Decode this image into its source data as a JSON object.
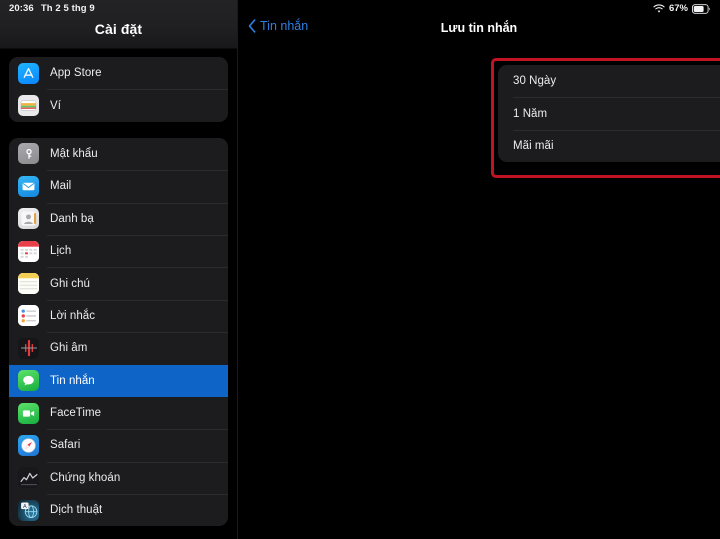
{
  "status_bar": {
    "time": "20:36",
    "date": "Th 2 5 thg 9",
    "wifi_icon": "wifi-icon",
    "battery_percent": "67%",
    "battery_icon": "battery-icon"
  },
  "sidebar": {
    "title": "Cài đặt",
    "groups": [
      {
        "items": [
          {
            "label": "App Store",
            "icon": "app-store-icon",
            "selected": false
          },
          {
            "label": "Ví",
            "icon": "wallet-icon",
            "selected": false
          }
        ]
      },
      {
        "items": [
          {
            "label": "Mật khẩu",
            "icon": "passwords-key-icon",
            "selected": false
          },
          {
            "label": "Mail",
            "icon": "mail-envelope-icon",
            "selected": false
          },
          {
            "label": "Danh bạ",
            "icon": "contacts-icon",
            "selected": false
          },
          {
            "label": "Lịch",
            "icon": "calendar-icon",
            "selected": false
          },
          {
            "label": "Ghi chú",
            "icon": "notes-icon",
            "selected": false
          },
          {
            "label": "Lời nhắc",
            "icon": "reminders-icon",
            "selected": false
          },
          {
            "label": "Ghi âm",
            "icon": "voice-memos-icon",
            "selected": false
          },
          {
            "label": "Tin nhắn",
            "icon": "messages-icon",
            "selected": true
          },
          {
            "label": "FaceTime",
            "icon": "facetime-icon",
            "selected": false
          },
          {
            "label": "Safari",
            "icon": "safari-compass-icon",
            "selected": false
          },
          {
            "label": "Chứng khoán",
            "icon": "stocks-icon",
            "selected": false
          },
          {
            "label": "Dịch thuật",
            "icon": "translate-icon",
            "selected": false
          }
        ]
      }
    ]
  },
  "content": {
    "back_label": "Tin nhắn",
    "back_icon": "chevron-left-icon",
    "title": "Lưu tin nhắn",
    "options": [
      {
        "label": "30 Ngày",
        "checked": true
      },
      {
        "label": "1 Năm",
        "checked": false
      },
      {
        "label": "Mãi mãi",
        "checked": false
      }
    ],
    "checkmark_icon": "checkmark-icon",
    "highlight_color": "#c01424"
  },
  "colors": {
    "selection_blue": "#0f64c8",
    "accent_blue": "#2f7fe0",
    "card_background": "#1c1c1e",
    "page_background": "#000000"
  }
}
